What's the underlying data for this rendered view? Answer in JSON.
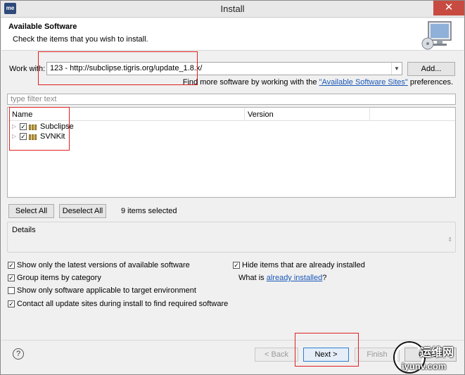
{
  "window": {
    "title": "Install",
    "app_icon_text": "me",
    "close_glyph": "✕"
  },
  "header": {
    "title": "Available Software",
    "subtitle": "Check the items that you wish to install.",
    "icon": "monitor-cd-icon"
  },
  "work_with": {
    "label": "Work with:",
    "value": "123 - http://subclipse.tigris.org/update_1.8.x/",
    "add_button": "Add...",
    "find_more_prefix": "Find more software by working with the ",
    "find_more_link": "\"Available Software Sites\"",
    "find_more_suffix": " preferences."
  },
  "filter": {
    "placeholder": "type filter text"
  },
  "tree": {
    "columns": [
      "Name",
      "Version"
    ],
    "items": [
      {
        "label": "Subclipse",
        "checked": true
      },
      {
        "label": "SVNKit",
        "checked": true
      }
    ]
  },
  "selection": {
    "select_all": "Select All",
    "deselect_all": "Deselect All",
    "count_text": "9 items selected"
  },
  "details": {
    "label": "Details"
  },
  "options": {
    "latest_versions": {
      "label": "Show only the latest versions of available software",
      "checked": true
    },
    "group_by_category": {
      "label": "Group items by category",
      "checked": true
    },
    "target_env": {
      "label": "Show only software applicable to target environment",
      "checked": false
    },
    "contact_sites": {
      "label": "Contact all update sites during install to find required software",
      "checked": true
    },
    "hide_installed": {
      "label": "Hide items that are already installed",
      "checked": true
    },
    "what_is_prefix": "What is ",
    "what_is_link": "already installed",
    "what_is_suffix": "?"
  },
  "footer": {
    "help_glyph": "?",
    "back": "< Back",
    "next": "Next >",
    "finish": "Finish",
    "cancel": "Cancel"
  },
  "watermark": {
    "line1": "运维网",
    "line2": "iyunv.com"
  },
  "colors": {
    "annotation_red": "#e02020",
    "link_blue": "#1b58b8",
    "close_red": "#c74b40"
  }
}
